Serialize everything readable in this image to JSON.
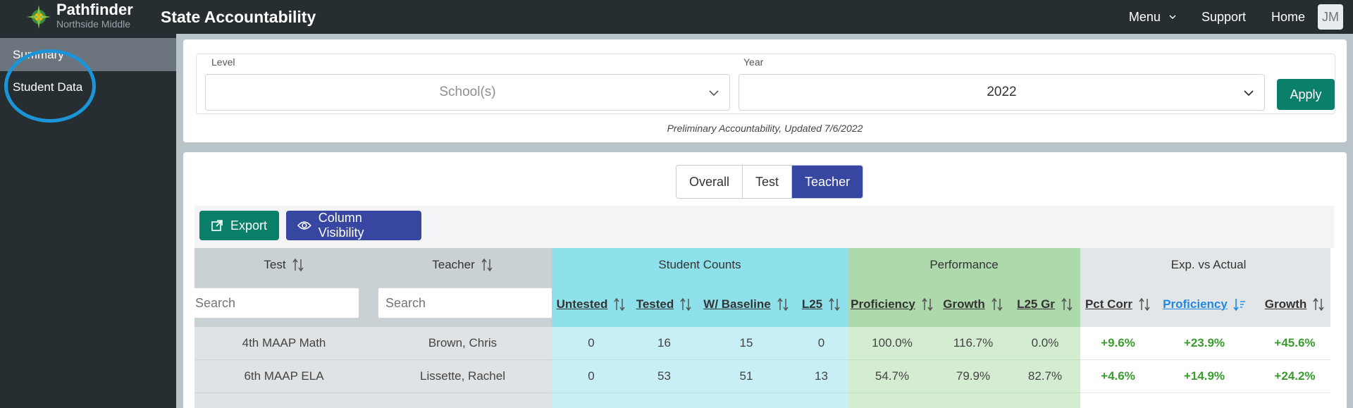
{
  "header": {
    "brand_name": "Pathfinder",
    "school_name": "Northside Middle",
    "app_title": "State Accountability",
    "nav": {
      "menu": "Menu",
      "support": "Support",
      "home": "Home",
      "avatar_initials": "JM"
    }
  },
  "sidebar": {
    "items": [
      {
        "label": "Summary"
      },
      {
        "label": "Student Data"
      }
    ]
  },
  "filters": {
    "level_label": "Level",
    "level_placeholder": "School(s)",
    "year_label": "Year",
    "year_value": "2022",
    "apply_label": "Apply",
    "note": "Preliminary Accountability, Updated 7/6/2022"
  },
  "view_tabs": [
    "Overall",
    "Test",
    "Teacher"
  ],
  "active_view": "Teacher",
  "toolbar": {
    "export_label": "Export",
    "column_visibility_label": "Column Visibility"
  },
  "table": {
    "groups": {
      "student_counts": "Student Counts",
      "performance": "Performance",
      "exp_vs_actual": "Exp. vs Actual"
    },
    "columns": {
      "test": "Test",
      "teacher": "Teacher",
      "untested": "Untested",
      "tested": "Tested",
      "w_baseline": "W/ Baseline",
      "l25": "L25",
      "proficiency": "Proficiency",
      "growth": "Growth",
      "l25_gr": "L25 Gr",
      "pct_corr": "Pct Corr",
      "exp_proficiency": "Proficiency",
      "exp_growth": "Growth"
    },
    "search_placeholder": "Search",
    "rows": [
      {
        "test": "4th MAAP Math",
        "teacher": "Brown, Chris",
        "untested": "0",
        "tested": "16",
        "w_baseline": "15",
        "l25": "0",
        "proficiency": "100.0%",
        "growth": "116.7%",
        "l25_gr": "0.0%",
        "pct_corr": "+9.6%",
        "exp_proficiency": "+23.9%",
        "exp_growth": "+45.6%"
      },
      {
        "test": "6th MAAP ELA",
        "teacher": "Lissette, Rachel",
        "untested": "0",
        "tested": "53",
        "w_baseline": "51",
        "l25": "13",
        "proficiency": "54.7%",
        "growth": "79.9%",
        "l25_gr": "82.7%",
        "pct_corr": "+4.6%",
        "exp_proficiency": "+14.9%",
        "exp_growth": "+24.2%"
      }
    ]
  },
  "colors": {
    "topbar": "#262e32",
    "accent_teal": "#0a7f6a",
    "accent_indigo": "#3746a0",
    "highlight_ring": "#1c94d8",
    "positive": "#3a9c2f"
  }
}
